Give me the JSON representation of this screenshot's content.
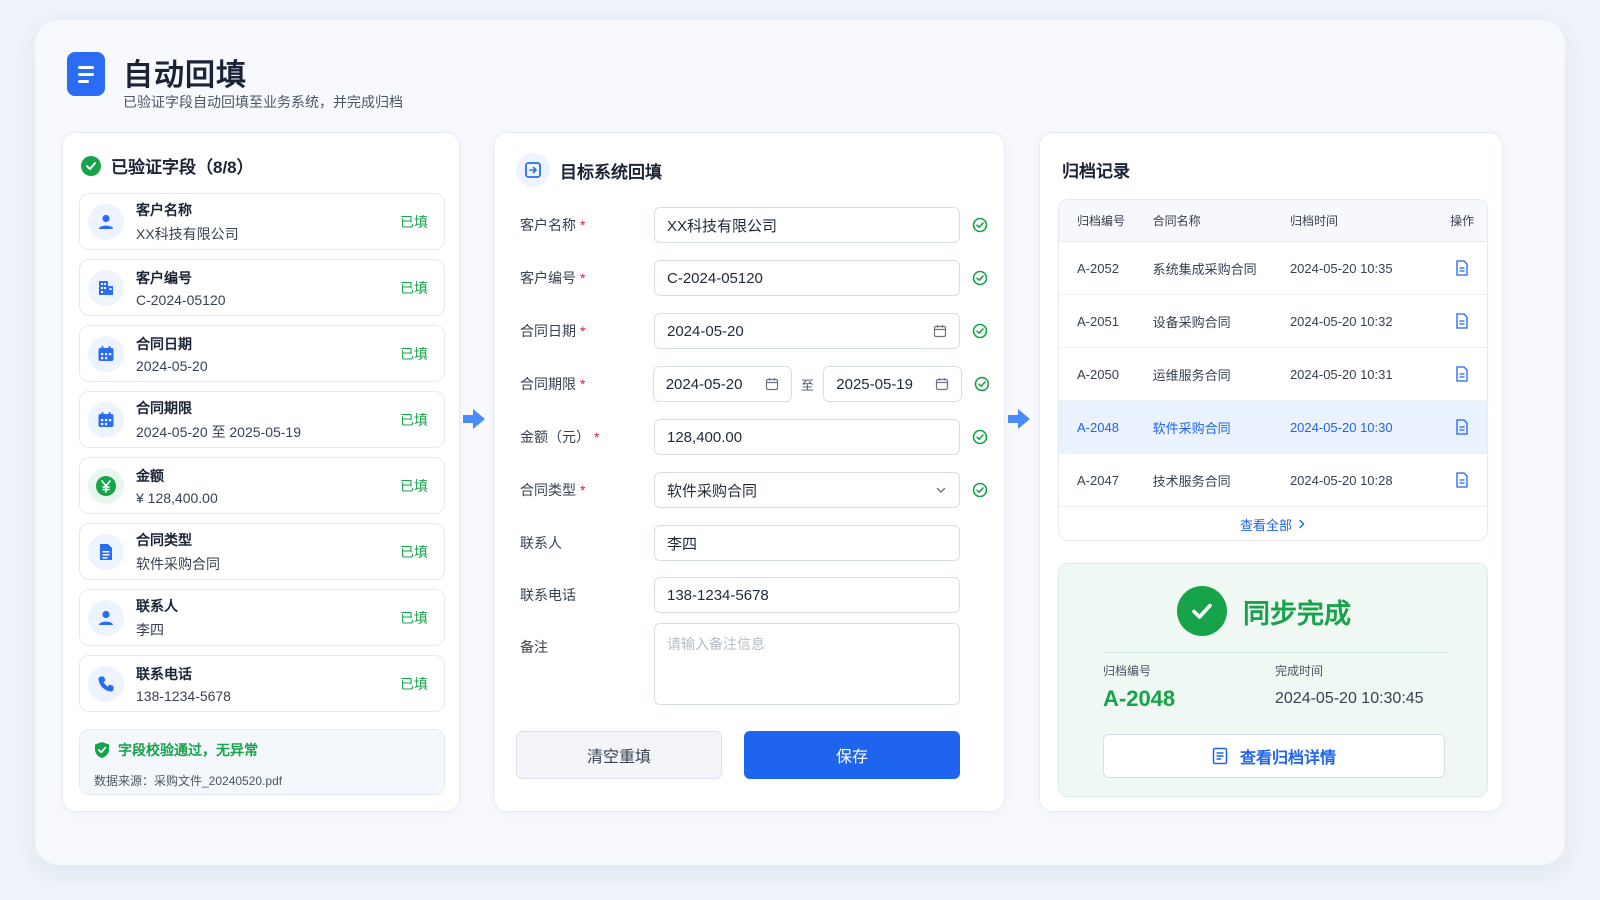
{
  "header": {
    "title": "自动回填",
    "subtitle": "已验证字段自动回填至业务系统，并完成归档"
  },
  "verified": {
    "title": "已验证字段（8/8）",
    "fields": [
      {
        "label": "客户名称",
        "value": "XX科技有限公司",
        "status": "已填",
        "icon": "user-icon"
      },
      {
        "label": "客户编号",
        "value": "C-2024-05120",
        "status": "已填",
        "icon": "building-icon"
      },
      {
        "label": "合同日期",
        "value": "2024-05-20",
        "status": "已填",
        "icon": "calendar-icon"
      },
      {
        "label": "合同期限",
        "value": "2024-05-20 至 2025-05-19",
        "status": "已填",
        "icon": "calendar-icon"
      },
      {
        "label": "金额",
        "value": "¥ 128,400.00",
        "status": "已填",
        "icon": "yen-icon"
      },
      {
        "label": "合同类型",
        "value": "软件采购合同",
        "status": "已填",
        "icon": "document-icon"
      },
      {
        "label": "联系人",
        "value": "李四",
        "status": "已填",
        "icon": "user-icon"
      },
      {
        "label": "联系电话",
        "value": "138-1234-5678",
        "status": "已填",
        "icon": "phone-icon"
      }
    ],
    "verify_text": "字段校验通过，无异常",
    "source_text": "数据来源：采购文件_20240520.pdf"
  },
  "form": {
    "title": "目标系统回填",
    "customer_name": {
      "label": "客户名称",
      "value": "XX科技有限公司"
    },
    "customer_id": {
      "label": "客户编号",
      "value": "C-2024-05120"
    },
    "contract_date": {
      "label": "合同日期",
      "value": "2024-05-20"
    },
    "contract_term": {
      "label": "合同期限",
      "start": "2024-05-20",
      "sep": "至",
      "end": "2025-05-19"
    },
    "amount": {
      "label": "金额（元）",
      "value": "128,400.00"
    },
    "contract_type": {
      "label": "合同类型",
      "value": "软件采购合同"
    },
    "contact": {
      "label": "联系人",
      "value": "李四"
    },
    "phone": {
      "label": "联系电话",
      "value": "138-1234-5678"
    },
    "remark": {
      "label": "备注",
      "placeholder": "请输入备注信息"
    },
    "required_mark": "*",
    "clear_label": "清空重填",
    "save_label": "保存"
  },
  "archive": {
    "title": "归档记录",
    "columns": [
      "归档编号",
      "合同名称",
      "归档时间",
      "操作"
    ],
    "rows": [
      {
        "id": "A-2052",
        "name": "系统集成采购合同",
        "time": "2024-05-20 10:35"
      },
      {
        "id": "A-2051",
        "name": "设备采购合同",
        "time": "2024-05-20 10:32"
      },
      {
        "id": "A-2050",
        "name": "运维服务合同",
        "time": "2024-05-20 10:31"
      },
      {
        "id": "A-2048",
        "name": "软件采购合同",
        "time": "2024-05-20 10:30"
      },
      {
        "id": "A-2047",
        "name": "技术服务合同",
        "time": "2024-05-20 10:28"
      }
    ],
    "view_all": "查看全部",
    "sync": {
      "title": "同步完成",
      "id_label": "归档编号",
      "id_value": "A-2048",
      "time_label": "完成时间",
      "time_value": "2024-05-20 10:30:45",
      "detail_button": "查看归档详情"
    }
  },
  "colors": {
    "primary": "#1f64ef",
    "success": "#16a34a",
    "required": "#e11d48"
  }
}
